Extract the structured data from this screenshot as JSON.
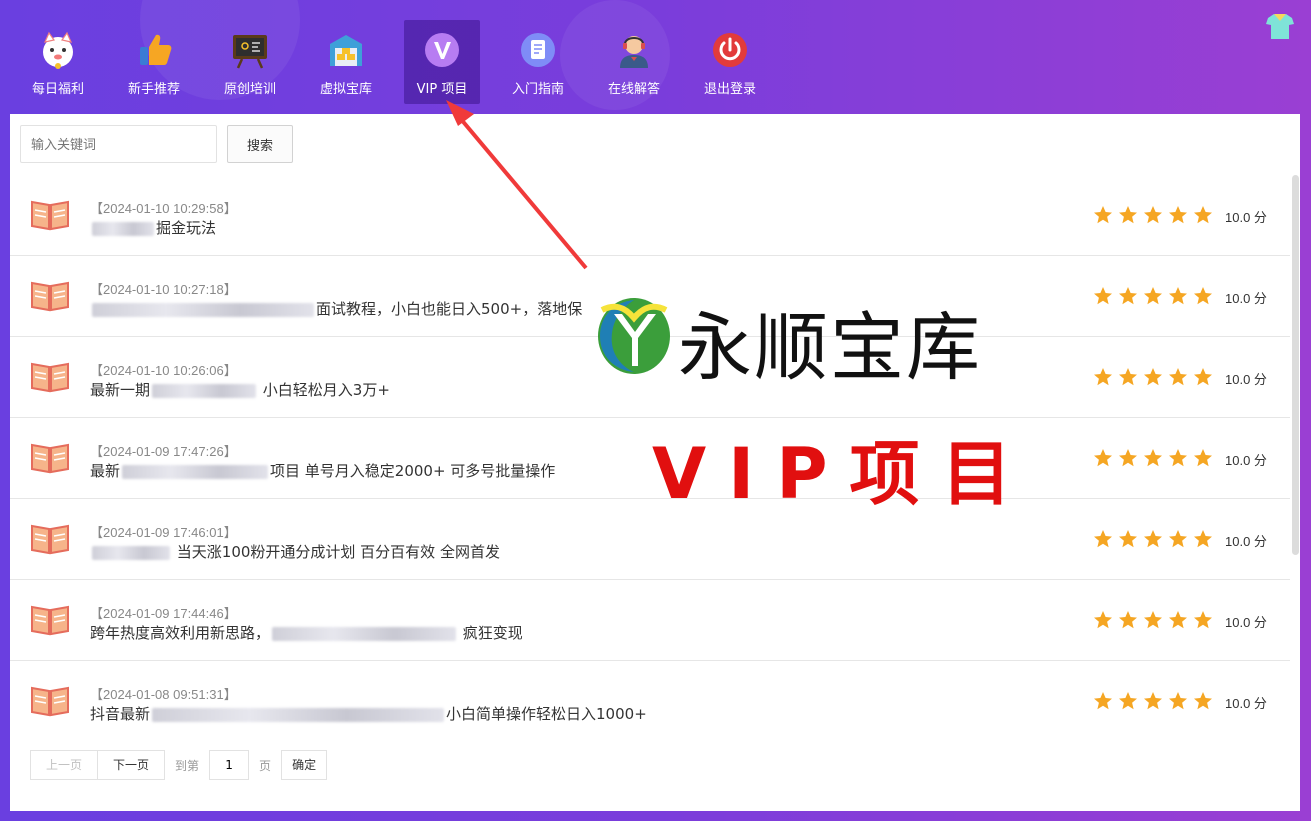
{
  "nav": {
    "items": [
      {
        "label": "每日福利",
        "icon": "lucky-cat-icon"
      },
      {
        "label": "新手推荐",
        "icon": "thumbs-up-icon"
      },
      {
        "label": "原创培训",
        "icon": "blackboard-icon"
      },
      {
        "label": "虚拟宝库",
        "icon": "warehouse-icon"
      },
      {
        "label": "VIP 项目",
        "icon": "vip-icon",
        "active": true
      },
      {
        "label": "入门指南",
        "icon": "document-icon"
      },
      {
        "label": "在线解答",
        "icon": "support-agent-icon"
      },
      {
        "label": "退出登录",
        "icon": "power-icon"
      }
    ]
  },
  "search": {
    "placeholder": "输入关键词",
    "button_label": "搜索"
  },
  "items": [
    {
      "date": "【2024-01-10 10:29:58】",
      "title": "掘金玩法",
      "stars": 5,
      "score": "10.0 分"
    },
    {
      "date": "【2024-01-10 10:27:18】",
      "title": "面试教程，小白也能日入500+，落地保",
      "stars": 5,
      "score": "10.0 分"
    },
    {
      "date": "【2024-01-10 10:26:06】",
      "title_prefix": "最新一期",
      "title": "小白轻松月入3万+",
      "stars": 5,
      "score": "10.0 分"
    },
    {
      "date": "【2024-01-09 17:47:26】",
      "title_prefix": "最新",
      "title": "项目 单号月入稳定2000+ 可多号批量操作",
      "stars": 5,
      "score": "10.0 分"
    },
    {
      "date": "【2024-01-09 17:46:01】",
      "title": "当天涨100粉开通分成计划 百分百有效 全网首发",
      "stars": 5,
      "score": "10.0 分"
    },
    {
      "date": "【2024-01-09 17:44:46】",
      "title_prefix": "跨年热度高效利用新思路，",
      "title": "疯狂变现",
      "stars": 5,
      "score": "10.0 分"
    },
    {
      "date": "【2024-01-08 09:51:31】",
      "title_prefix": "抖音最新",
      "title": "小白简单操作轻松日入1000+",
      "stars": 5,
      "score": "10.0 分"
    }
  ],
  "pagination": {
    "prev_label": "上一页",
    "next_label": "下一页",
    "goto_label": "到第",
    "page_value": "1",
    "page_unit": "页",
    "confirm_label": "确定"
  },
  "watermark": {
    "brand": "永顺宝库",
    "vip_text": "VIP项目"
  },
  "colors": {
    "accent_purple": "#6a3fe0",
    "star": "#f5a623",
    "watermark_red": "#e10f0f"
  }
}
